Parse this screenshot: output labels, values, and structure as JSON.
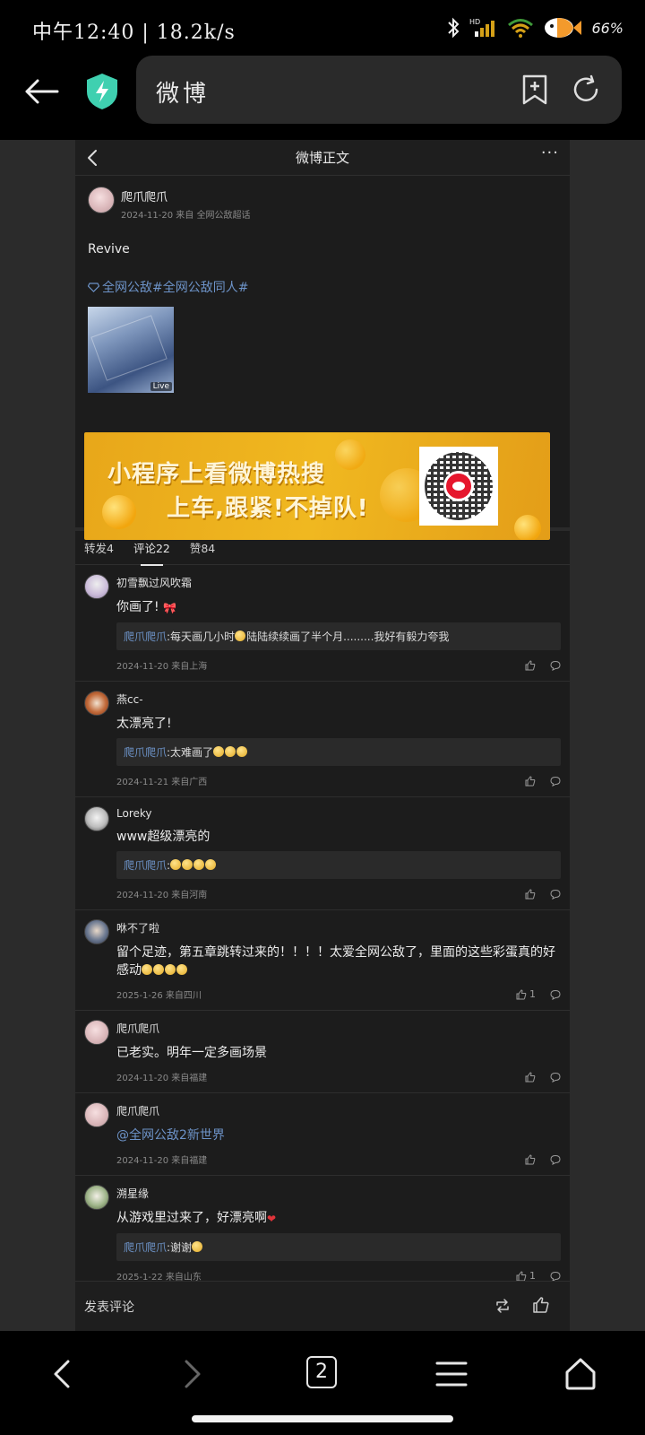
{
  "status": {
    "time_speed": "中午12:40 | 18.2k/s",
    "battery": "66%",
    "hd_label": "HD"
  },
  "browser": {
    "url_title": "微博"
  },
  "page": {
    "nav_title": "微博正文",
    "nav_more": "···"
  },
  "post": {
    "author": "爬爪爬爪",
    "meta": "2024-11-20 来自 全网公敌超话",
    "text": "Revive",
    "tags": "全网公敌#全网公敌同人#",
    "live_badge": "Live"
  },
  "banner": {
    "line1": "小程序上看微博热搜",
    "line2": "上车,跟紧!不掉队!"
  },
  "tabs": [
    {
      "label": "转发4"
    },
    {
      "label": "评论22"
    },
    {
      "label": "赞84"
    }
  ],
  "comments": [
    {
      "name": "初雪飘过风吹霜",
      "text": "你画了!",
      "reply_name": "爬爪爬爪",
      "reply_text": ":每天画几小时",
      "reply_tail": "陆陆续续画了半个月.........我好有毅力夸我",
      "meta": "2024-11-20 来自上海",
      "likes": ""
    },
    {
      "name": "燕cc-",
      "text": "太漂亮了!",
      "reply_name": "爬爪爬爪",
      "reply_text": ":太难画了",
      "meta": "2024-11-21 来自广西",
      "likes": ""
    },
    {
      "name": "Loreky",
      "text": "www超级漂亮的",
      "reply_name": "爬爪爬爪",
      "reply_text": ":",
      "meta": "2024-11-20 来自河南",
      "likes": ""
    },
    {
      "name": "咻不了啦",
      "text": "留个足迹，第五章跳转过来的！！！！太爱全网公敌了，里面的这些彩蛋真的好感动",
      "meta": "2025-1-26 来自四川",
      "likes": "1"
    },
    {
      "name": "爬爪爬爪",
      "text": "已老实。明年一定多画场景",
      "meta": "2024-11-20 来自福建",
      "likes": ""
    },
    {
      "name": "爬爪爬爪",
      "text": "@全网公敌2新世界",
      "meta": "2024-11-20 来自福建",
      "likes": ""
    },
    {
      "name": "溯星缘",
      "text": "从游戏里过来了，好漂亮啊",
      "reply_name": "爬爪爬爪",
      "reply_text": ":谢谢",
      "meta": "2025-1-22 来自山东",
      "likes": "1"
    }
  ],
  "bottom": {
    "comment_placeholder": "发表评论"
  },
  "browser_bottom": {
    "tab_count": "2"
  }
}
